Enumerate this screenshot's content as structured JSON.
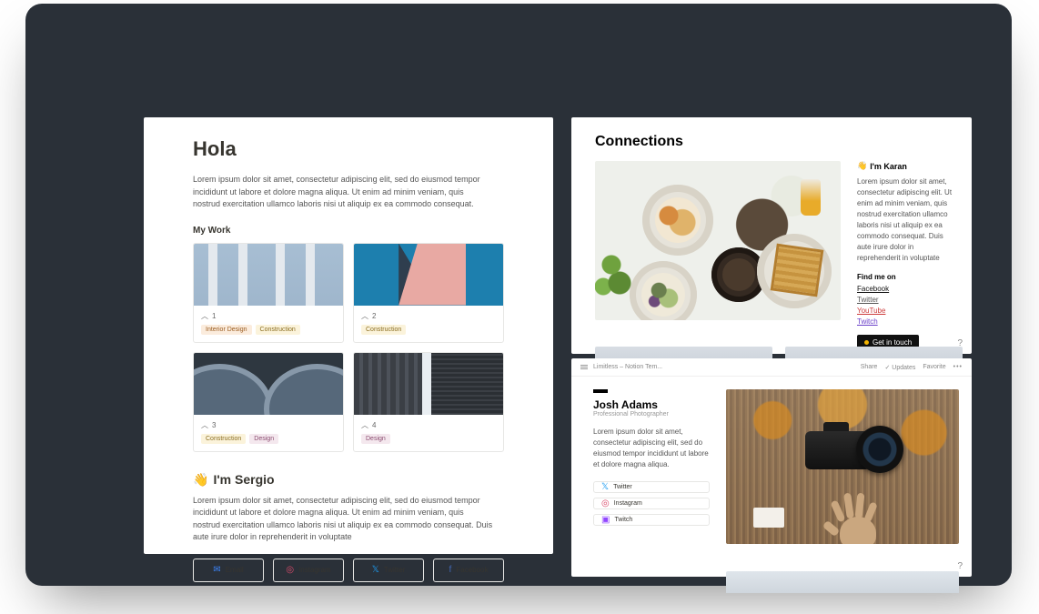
{
  "panelA": {
    "heading": "Hola",
    "intro": "Lorem ipsum dolor sit amet, consectetur adipiscing elit, sed do eiusmod tempor incididunt ut labore et dolore magna aliqua. Ut enim ad minim veniam, quis nostrud exercitation ullamco laboris nisi ut aliquip ex ea commodo consequat.",
    "work_heading": "My Work",
    "cards": [
      {
        "num": "1",
        "tags": [
          "Interior Design",
          "Construction"
        ],
        "tag_classes": [
          "orange",
          "yellow"
        ]
      },
      {
        "num": "2",
        "tags": [
          "Construction"
        ],
        "tag_classes": [
          "yellow"
        ]
      },
      {
        "num": "3",
        "tags": [
          "Construction",
          "Design"
        ],
        "tag_classes": [
          "yellow",
          "purple"
        ]
      },
      {
        "num": "4",
        "tags": [
          "Design"
        ],
        "tag_classes": [
          "purple"
        ]
      }
    ],
    "sergio_heading": "I'm Sergio",
    "sergio_body": "Lorem ipsum dolor sit amet, consectetur adipiscing elit, sed do eiusmod tempor incididunt ut labore et dolore magna aliqua. Ut enim ad minim veniam, quis nostrud exercitation ullamco laboris nisi ut aliquip ex ea commodo consequat. Duis aute irure dolor in reprehenderit in voluptate",
    "socials": {
      "email": "Email",
      "instagram": "Instagram",
      "twitter": "Twitter",
      "facebook": "Facebook"
    }
  },
  "panelB": {
    "heading": "Connections",
    "hi": "I'm Karan",
    "body": "Lorem ipsum dolor sit amet, consectetur adipiscing elit. Ut enim ad minim veniam, quis nostrud exercitation ullamco laboris nisi ut aliquip ex ea commodo consequat. Duis aute irure dolor in reprehenderit in voluptate",
    "findme": "Find me on",
    "links": {
      "facebook": "Facebook",
      "twitter": "Twitter",
      "youtube": "YouTube",
      "twitch": "Twitch"
    },
    "cta": "Get in touch",
    "help": "?"
  },
  "panelC": {
    "breadcrumb": "Limitless – Notion Tem...",
    "toolbar": {
      "share": "Share",
      "updates": "Updates",
      "favorite": "Favorite"
    },
    "name": "Josh Adams",
    "subtitle": "Professional Photographer",
    "body": "Lorem ipsum dolor sit amet, consectetur adipiscing elit, sed do eiusmod tempor incididunt ut labore et dolore magna aliqua.",
    "socials": {
      "twitter": "Twitter",
      "instagram": "Instagram",
      "twitch": "Twitch"
    },
    "help": "?"
  }
}
